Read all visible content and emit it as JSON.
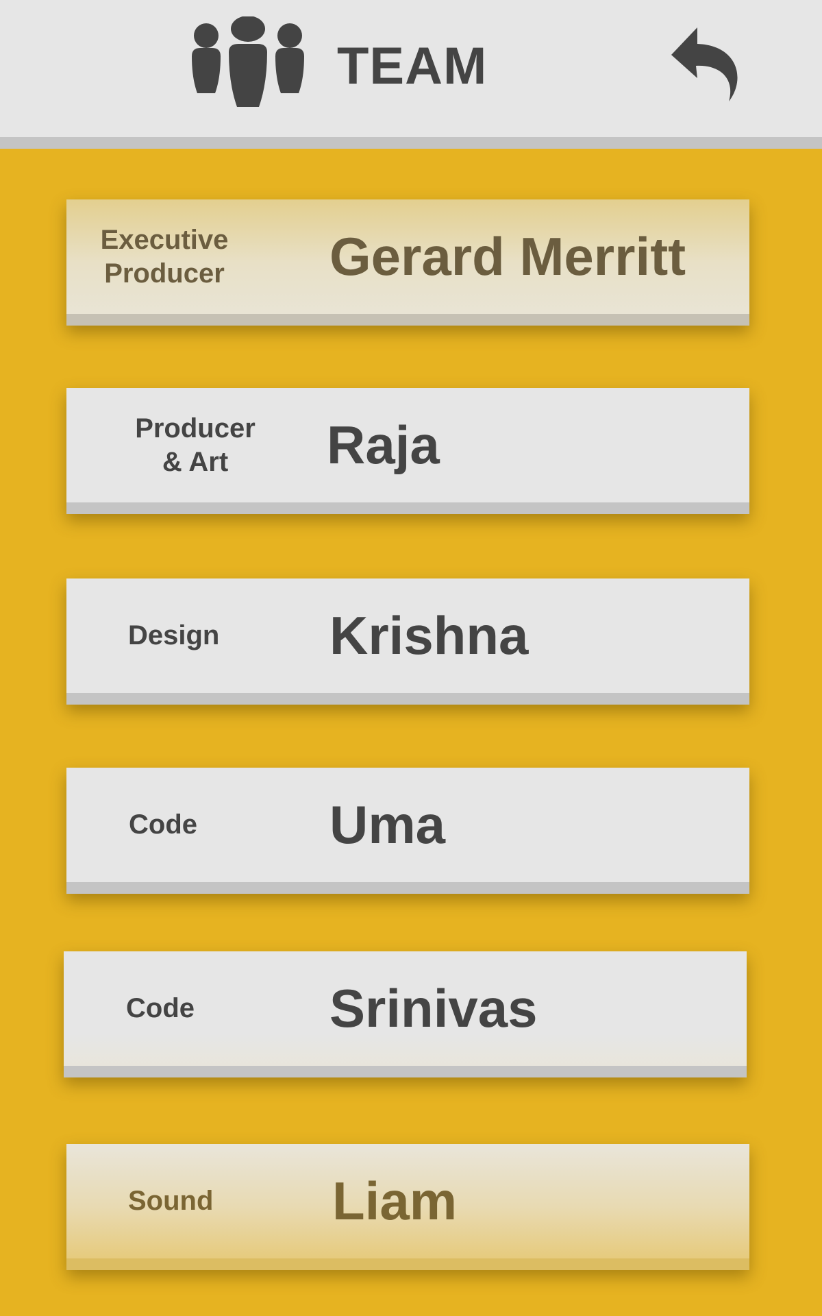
{
  "header": {
    "title": "TEAM",
    "team_icon": "people-group-icon",
    "back_icon": "back-arrow-icon"
  },
  "colors": {
    "background": "#e6b321",
    "header": "#e6e6e6",
    "card": "#e6e6e6",
    "card_strip": "#c4c4c4",
    "text": "#444444"
  },
  "team": [
    {
      "role": "Executive\nProducer",
      "name": "Gerard Merritt",
      "state": "highlighted"
    },
    {
      "role": "Producer\n& Art",
      "name": "Raja",
      "state": "normal"
    },
    {
      "role": "Design",
      "name": "Krishna",
      "state": "normal"
    },
    {
      "role": "Code",
      "name": "Uma",
      "state": "normal"
    },
    {
      "role": "Code",
      "name": "Srinivas",
      "state": "normal"
    },
    {
      "role": "Sound",
      "name": "Liam",
      "state": "highlighted"
    }
  ]
}
